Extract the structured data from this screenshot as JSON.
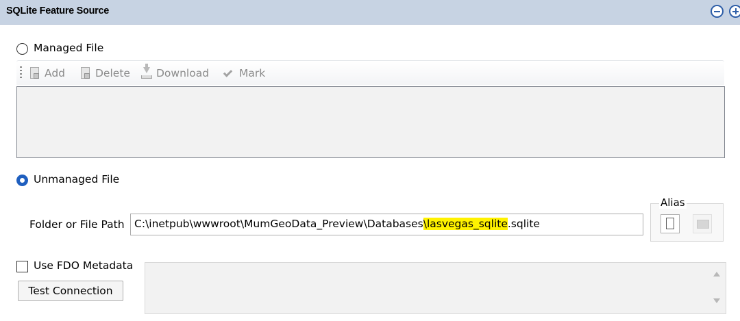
{
  "header": {
    "title": "SQLite Feature Source"
  },
  "managed": {
    "radio_label": "Managed File",
    "toolbar": {
      "add": "Add",
      "delete": "Delete",
      "download": "Download",
      "mark": "Mark"
    }
  },
  "unmanaged": {
    "radio_label": "Unmanaged File",
    "path_label": "Folder or File Path",
    "path_prefix": "C:\\inetpub\\wwwroot\\MumGeoData_Preview\\Databases",
    "path_highlight": "\\lasvegas_sqlite",
    "path_suffix": ".sqlite",
    "alias_label": "Alias"
  },
  "metadata": {
    "checkbox_label": "Use FDO Metadata",
    "checked": false
  },
  "test_button": "Test Connection",
  "colors": {
    "header_bg": "#c7d3e3",
    "accent": "#1f5fbf",
    "highlight": "#fff200"
  }
}
